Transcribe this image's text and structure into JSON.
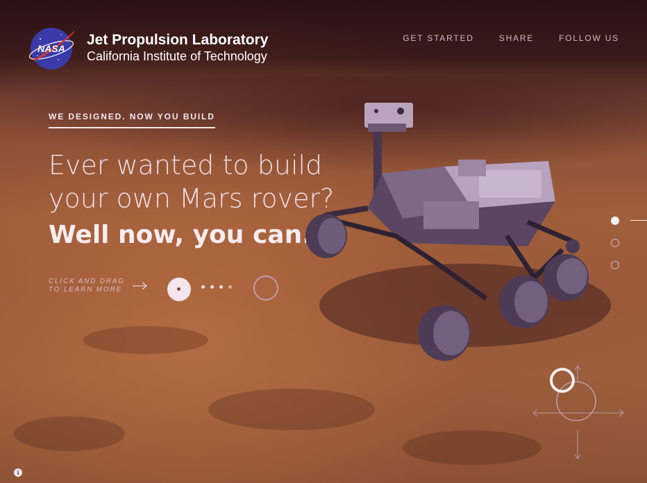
{
  "brand": {
    "logo_text": "NASA",
    "title": "Jet Propulsion Laboratory",
    "subtitle": "California Institute of Technology"
  },
  "nav": {
    "items": [
      {
        "label": "GET STARTED"
      },
      {
        "label": "SHARE"
      },
      {
        "label": "FOLLOW US"
      }
    ]
  },
  "hero": {
    "eyebrow": "WE DESIGNED. NOW YOU BUILD",
    "headline_line1": "Ever wanted to build",
    "headline_line2": "your own Mars rover?",
    "headline_strong": "Well now, you can.",
    "cta_line1": "CLICK AND DRAG",
    "cta_line2": "TO LEARN MORE"
  },
  "slider": {
    "dot_count": 4
  },
  "side_nav": {
    "sections": 3,
    "active_index": 0
  },
  "info_button": {
    "label": "i"
  },
  "colors": {
    "accent_text": "#d9b6c7",
    "headline_text": "#f1dfe6",
    "mars_ground": "#a05f3c",
    "sky": "#2b1214",
    "nasa_blue": "#3a3aa8"
  },
  "icons": {
    "logo": "nasa-meatball-icon",
    "cta_arrow": "arrow-right-icon",
    "info": "info-icon",
    "compass": "rotate-compass-icon"
  }
}
